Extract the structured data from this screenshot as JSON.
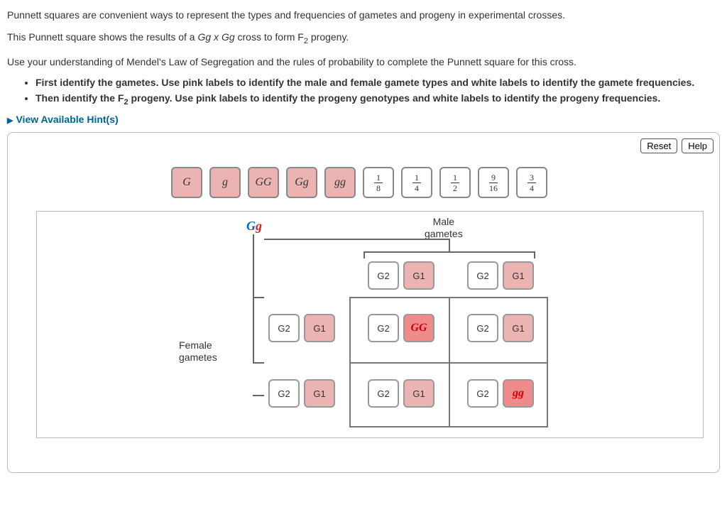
{
  "intro": {
    "p1": "Punnett squares are convenient ways to represent the types and frequencies of gametes and progeny in experimental crosses.",
    "p2a": "This Punnett square shows the results of a ",
    "p2cross": "Gg x Gg",
    "p2b": " cross to form F",
    "p2sub": "2",
    "p2c": " progeny.",
    "p3": "Use your understanding of Mendel's Law of Segregation and the rules of probability to complete the Punnett square for this cross."
  },
  "bullets": {
    "b1": "First identify the gametes. Use pink labels to identify the male and female gamete types and white labels to identify the gamete frequencies.",
    "b2a": "Then identify the F",
    "b2sub": "2",
    "b2b": " progeny. Use pink labels to identify the progeny genotypes and white labels to identify the progeny frequencies."
  },
  "hints": "View Available Hint(s)",
  "buttons": {
    "reset": "Reset",
    "help": "Help"
  },
  "tokens": {
    "pink": [
      "G",
      "g",
      "GG",
      "Gg",
      "gg"
    ],
    "fractions": [
      {
        "num": "1",
        "den": "8"
      },
      {
        "num": "1",
        "den": "4"
      },
      {
        "num": "1",
        "den": "2"
      },
      {
        "num": "9",
        "den": "16"
      },
      {
        "num": "3",
        "den": "4"
      }
    ]
  },
  "labels": {
    "gg_blue": "G",
    "gg_red": "g",
    "male": "Male\ngametes",
    "female": "Female\ngametes"
  },
  "slots": {
    "g2": "G2",
    "g1": "G1",
    "GG": "GG",
    "gg": "gg"
  }
}
